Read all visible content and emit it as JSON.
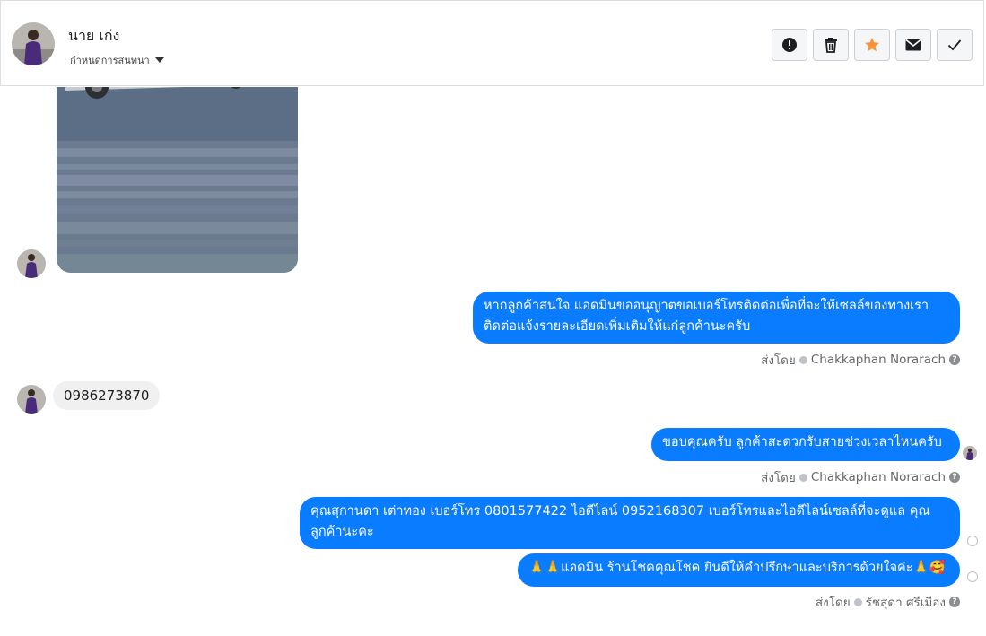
{
  "header": {
    "contact_name": "นาย เก่ง",
    "assign_label": "กำหนดการสนทนา",
    "actions": [
      {
        "name": "spam",
        "icon": "alert-circle-icon"
      },
      {
        "name": "delete",
        "icon": "trash-icon"
      },
      {
        "name": "star",
        "icon": "star-icon"
      },
      {
        "name": "mark-unread",
        "icon": "envelope-icon"
      },
      {
        "name": "done",
        "icon": "checkmark-icon"
      }
    ]
  },
  "messages": {
    "m1": "หากลูกค้าสนใจ แอดมินขออนุญาตขอเบอร์โทรติดต่อเพื่อที่จะให้เซลล์ของทางเรา ติดต่อแจ้งรายละเอียดเพิ่มเติมให้แก่ลูกค้านะครับ",
    "m1_sent_prefix": "ส่งโดย",
    "m1_sender": "Chakkaphan Norarach",
    "m2": "0986273870",
    "m3": "ขอบคุณครับ ลูกค้าสะดวกรับสายช่วงเวลาไหนครับ",
    "m3_sent_prefix": "ส่งโดย",
    "m3_sender": "Chakkaphan Norarach",
    "m4": "คุณสุกานดา เต่าทอง      เบอร์โทร 0801577422  ไอดีไลน์ 0952168307   เบอร์โทรและไอดีไลน์เซลล์ที่จะดูแล คุณลูกค้านะคะ",
    "m5": "🙏🙏แอดมิน ร้านโชคคุณโชค ยินดีให้คำปรึกษาและบริการด้วยใจค่ะ🙏🥰",
    "m5_sent_prefix": "ส่งโดย",
    "m5_sender": "รัชสุดา ศรีเมือง"
  },
  "colors": {
    "accent": "#0a7cff",
    "star": "#f7923b",
    "incoming_bubble": "#f0f0f0"
  }
}
